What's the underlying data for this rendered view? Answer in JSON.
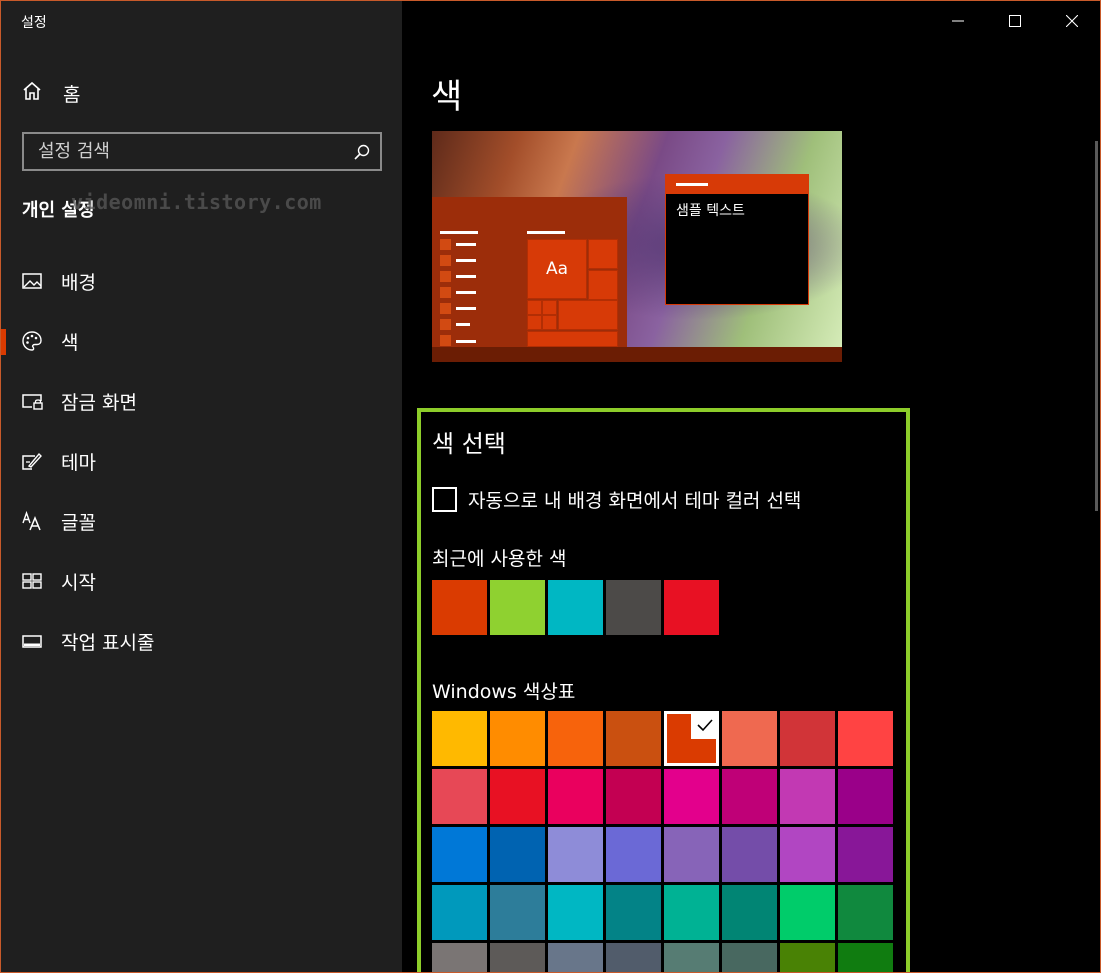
{
  "window": {
    "title": "설정"
  },
  "sidebar": {
    "home_label": "홈",
    "search_placeholder": "설정 검색",
    "section_heading": "개인 설정",
    "watermark": "videomni.tistory.com",
    "items": [
      {
        "label": "배경",
        "icon": "image-icon",
        "active": false
      },
      {
        "label": "색",
        "icon": "palette-icon",
        "active": true
      },
      {
        "label": "잠금 화면",
        "icon": "lock-screen-icon",
        "active": false
      },
      {
        "label": "테마",
        "icon": "theme-icon",
        "active": false
      },
      {
        "label": "글꼴",
        "icon": "font-icon",
        "active": false
      },
      {
        "label": "시작",
        "icon": "start-icon",
        "active": false
      },
      {
        "label": "작업 표시줄",
        "icon": "taskbar-icon",
        "active": false
      }
    ]
  },
  "main": {
    "title": "색",
    "preview": {
      "tile_label": "Aa",
      "sample_text": "샘플 텍스트"
    },
    "choose_title": "색 선택",
    "auto_accent_label": "자동으로 내 배경 화면에서 테마 컬러 선택",
    "auto_accent_checked": false,
    "recent_title": "최근에 사용한 색",
    "recent_colors": [
      "#da3b01",
      "#8fd130",
      "#00b7c3",
      "#4c4a48",
      "#e81123"
    ],
    "palette_title": "Windows 색상표",
    "palette_selected_index": 4,
    "palette_colors": [
      "#ffb900",
      "#ff8c00",
      "#f7630c",
      "#ca5010",
      "#da3b01",
      "#ef6950",
      "#d13438",
      "#ff4343",
      "#e74856",
      "#e81123",
      "#ea005e",
      "#c30052",
      "#e3008c",
      "#bf0077",
      "#c239b3",
      "#9a0089",
      "#0078d7",
      "#0063b1",
      "#8e8cd8",
      "#6b69d6",
      "#8764b8",
      "#744da9",
      "#b146c2",
      "#881798",
      "#0099bc",
      "#2d7d9a",
      "#00b7c3",
      "#038387",
      "#00b294",
      "#018574",
      "#00cc6a",
      "#10893e",
      "#7a7574",
      "#5d5a58",
      "#68768a",
      "#515c6b",
      "#567c73",
      "#486860",
      "#498205",
      "#107c10"
    ]
  },
  "colors": {
    "accent": "#da3b01",
    "highlight_border": "#8dcd2a",
    "sidebar_bg": "#1f1f1f"
  }
}
